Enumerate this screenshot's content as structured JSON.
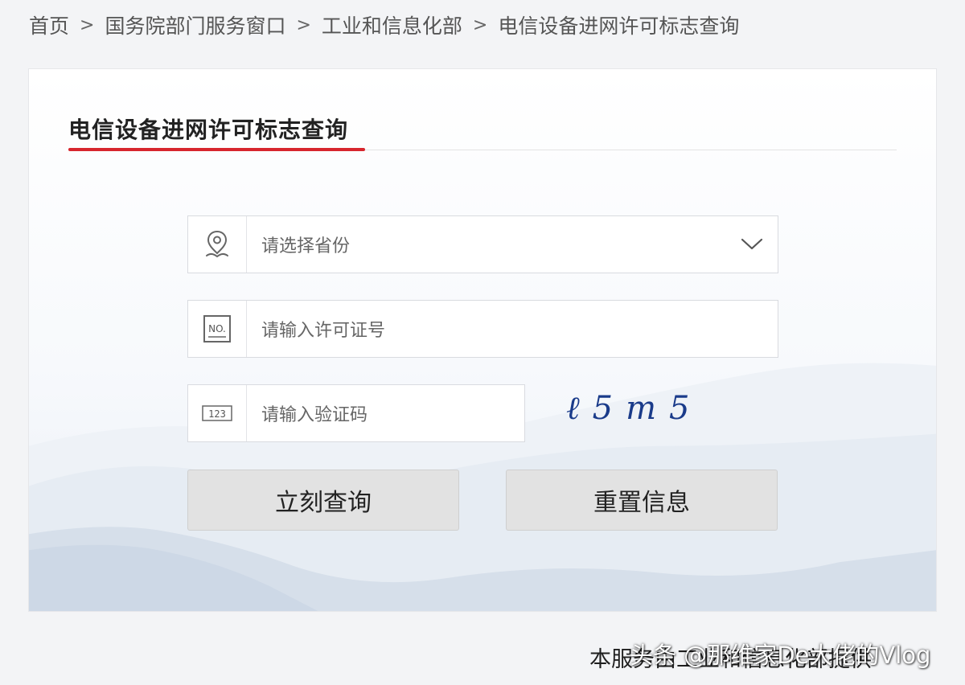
{
  "breadcrumb": {
    "items": [
      "首页",
      "国务院部门服务窗口",
      "工业和信息化部",
      "电信设备进网许可标志查询"
    ],
    "separator": ">"
  },
  "panel": {
    "title": "电信设备进网许可标志查询"
  },
  "form": {
    "province": {
      "placeholder": "请选择省份",
      "icon": "location-pin-icon"
    },
    "license": {
      "placeholder": "请输入许可证号",
      "icon": "no-badge-icon",
      "icon_text": "NO."
    },
    "captcha_input": {
      "placeholder": "请输入验证码",
      "icon": "numeric-123-icon",
      "icon_text": "123"
    },
    "captcha_image_text": "ℓ5m5",
    "buttons": {
      "query": "立刻查询",
      "reset": "重置信息"
    }
  },
  "footer": {
    "note": "本服务由工业和信息化部提供",
    "watermark": "头条 @那维家De大佬的Vlog"
  },
  "colors": {
    "accent": "#d7262d",
    "captcha": "#1a3b8a"
  }
}
